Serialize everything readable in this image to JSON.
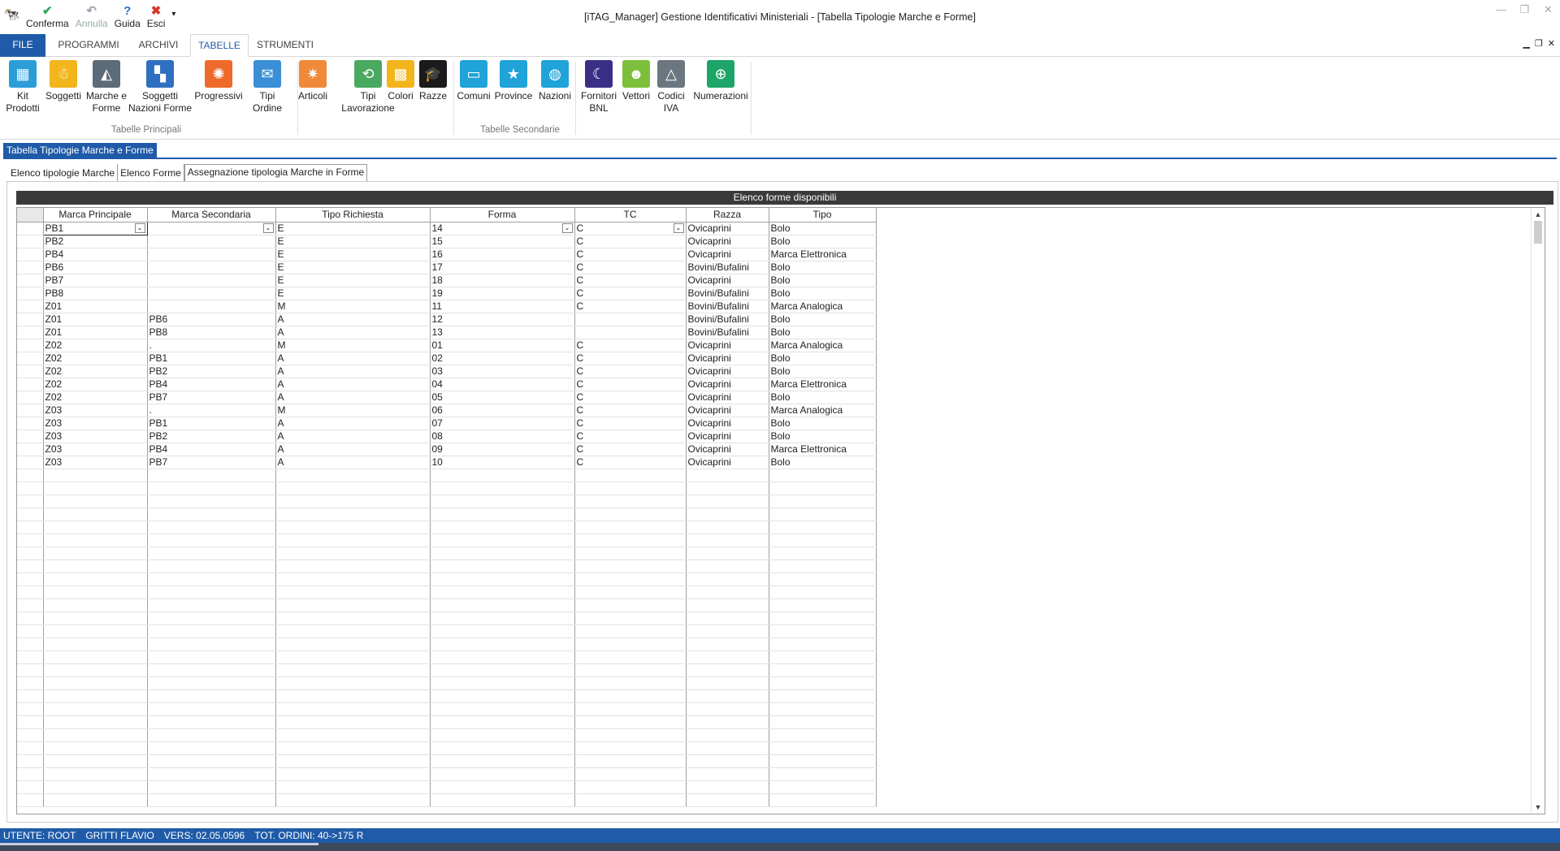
{
  "window": {
    "title": "[iTAG_Manager] Gestione Identificativi Ministeriali - [Tabella Tipologie Marche e Forme]"
  },
  "quick_access": [
    {
      "label": "Conferma",
      "icon": "check-icon",
      "color": "#3aa55d",
      "enabled": true
    },
    {
      "label": "Annulla",
      "icon": "undo-icon",
      "color": "#9aa4b0",
      "enabled": false
    },
    {
      "label": "Guida",
      "icon": "help-icon",
      "color": "#2f6fc2",
      "enabled": true
    },
    {
      "label": "Esci",
      "icon": "close-icon",
      "color": "#d9342b",
      "enabled": true
    }
  ],
  "menu_tabs": [
    "FILE",
    "PROGRAMMI",
    "ARCHIVI",
    "TABELLE",
    "STRUMENTI"
  ],
  "active_menu_tab": "TABELLE",
  "ribbon": {
    "group_principal_label": "Tabelle Principali",
    "group_secondary_label": "Tabelle Secondarie",
    "buttons": [
      {
        "label": "Kit\nProdotti",
        "icon": "kit-icon",
        "color": "#2b9ed8"
      },
      {
        "label": "Soggetti",
        "icon": "linux-icon",
        "color": "#f2b51c"
      },
      {
        "label": "Marche e\nForme",
        "icon": "shapes-icon",
        "color": "#5c6b78"
      },
      {
        "label": "Soggetti\nNazioni Forme",
        "icon": "grid-icon",
        "color": "#2f6fc2"
      },
      {
        "label": "Progressivi",
        "icon": "ubuntu-icon",
        "color": "#ee6a2a"
      },
      {
        "label": "Tipi\nOrdine",
        "icon": "order-icon",
        "color": "#3a8fd6"
      },
      {
        "label": "Articoli",
        "icon": "article-icon",
        "color": "#f08a3a"
      },
      {
        "label": "Tipi\nLavorazione",
        "icon": "process-icon",
        "color": "#4aa860"
      },
      {
        "label": "Colori",
        "icon": "colors-icon",
        "color": "#f2b51c"
      },
      {
        "label": "Razze",
        "icon": "breed-icon",
        "color": "#1a1a1a"
      },
      {
        "label": "Comuni",
        "icon": "folder-icon",
        "color": "#1fa3d8"
      },
      {
        "label": "Province",
        "icon": "folder-star-icon",
        "color": "#1fa3d8"
      },
      {
        "label": "Nazioni",
        "icon": "folder-globe-icon",
        "color": "#1fa3d8"
      },
      {
        "label": "Fornitori\nBNL",
        "icon": "moon-icon",
        "color": "#3a2f86"
      },
      {
        "label": "Vettori",
        "icon": "android-icon",
        "color": "#7cbf3a"
      },
      {
        "label": "Codici\nIVA",
        "icon": "triangle-icon",
        "color": "#6b7680"
      },
      {
        "label": "Numerazioni",
        "icon": "numbers-icon",
        "color": "#1ea56a"
      }
    ]
  },
  "panel_title": "Tabella Tipologie Marche e Forme",
  "sub_tabs": [
    "Elenco tipologie Marche",
    "Elenco Forme",
    "Assegnazione tipologia Marche in Forme"
  ],
  "active_sub_tab": "Assegnazione tipologia Marche in Forme",
  "grid": {
    "header": "Elenco forme disponibili",
    "columns": [
      "Marca Principale",
      "Marca Secondaria",
      "Tipo Richiesta",
      "Forma",
      "TC",
      "Razza",
      "Tipo"
    ],
    "rows": [
      [
        "PB1",
        "",
        "E",
        "14",
        "C",
        "Ovicaprini",
        "Bolo"
      ],
      [
        "PB2",
        "",
        "E",
        "15",
        "C",
        "Ovicaprini",
        "Bolo"
      ],
      [
        "PB4",
        "",
        "E",
        "16",
        "C",
        "Ovicaprini",
        "Marca Elettronica"
      ],
      [
        "PB6",
        "",
        "E",
        "17",
        "C",
        "Bovini/Bufalini",
        "Bolo"
      ],
      [
        "PB7",
        "",
        "E",
        "18",
        "C",
        "Ovicaprini",
        "Bolo"
      ],
      [
        "PB8",
        "",
        "E",
        "19",
        "C",
        "Bovini/Bufalini",
        "Bolo"
      ],
      [
        "Z01",
        "",
        "M",
        "11",
        "C",
        "Bovini/Bufalini",
        "Marca Analogica"
      ],
      [
        "Z01",
        "PB6",
        "A",
        "12",
        "",
        "Bovini/Bufalini",
        "Bolo"
      ],
      [
        "Z01",
        "PB8",
        "A",
        "13",
        "",
        "Bovini/Bufalini",
        "Bolo"
      ],
      [
        "Z02",
        ".",
        "M",
        "01",
        "C",
        "Ovicaprini",
        "Marca Analogica"
      ],
      [
        "Z02",
        "PB1",
        "A",
        "02",
        "C",
        "Ovicaprini",
        "Bolo"
      ],
      [
        "Z02",
        "PB2",
        "A",
        "03",
        "C",
        "Ovicaprini",
        "Bolo"
      ],
      [
        "Z02",
        "PB4",
        "A",
        "04",
        "C",
        "Ovicaprini",
        "Marca Elettronica"
      ],
      [
        "Z02",
        "PB7",
        "A",
        "05",
        "C",
        "Ovicaprini",
        "Bolo"
      ],
      [
        "Z03",
        ".",
        "M",
        "06",
        "C",
        "Ovicaprini",
        "Marca Analogica"
      ],
      [
        "Z03",
        "PB1",
        "A",
        "07",
        "C",
        "Ovicaprini",
        "Bolo"
      ],
      [
        "Z03",
        "PB2",
        "A",
        "08",
        "C",
        "Ovicaprini",
        "Bolo"
      ],
      [
        "Z03",
        "PB4",
        "A",
        "09",
        "C",
        "Ovicaprini",
        "Marca Elettronica"
      ],
      [
        "Z03",
        "PB7",
        "A",
        "10",
        "C",
        "Ovicaprini",
        "Bolo"
      ]
    ]
  },
  "status": {
    "user": "UTENTE: ROOT",
    "name": "GRITTI FLAVIO",
    "version": "VERS: 02.05.0596",
    "orders": "TOT. ORDINI: 40->175 R"
  }
}
